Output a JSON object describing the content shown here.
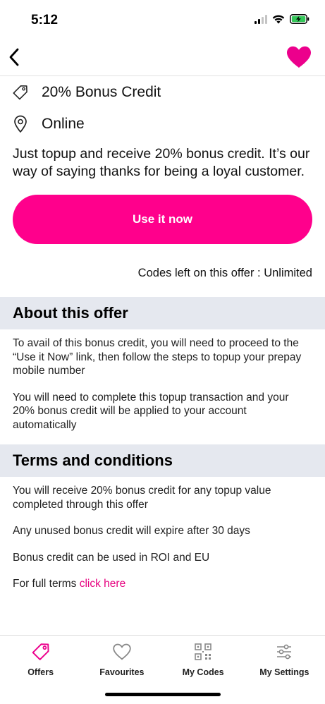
{
  "status_bar": {
    "time": "5:12",
    "icons": [
      "signal-icon",
      "wifi-icon",
      "battery-charging-icon"
    ]
  },
  "nav": {
    "back_icon": "chevron-left-icon",
    "favourite_icon": "heart-filled-icon",
    "accent_color": "#ff008c"
  },
  "offer": {
    "tag_icon": "tag-icon",
    "title": "20% Bonus Credit",
    "location_icon": "location-pin-icon",
    "location": "Online",
    "description": "Just topup and receive 20% bonus credit. It’s our way of saying thanks for being a loyal customer.",
    "cta_label": "Use it now",
    "codes_left": "Codes left on this offer : Unlimited"
  },
  "about": {
    "heading": "About this offer",
    "paragraphs": [
      "To avail of this bonus credit, you will need to proceed to the “Use it Now” link, then follow the steps to topup your prepay mobile number",
      "You will need to complete this topup transaction and your 20% bonus credit will be applied to your account automatically"
    ]
  },
  "terms": {
    "heading": "Terms and conditions",
    "paragraphs": [
      "You will receive 20% bonus credit for any topup value completed through this offer",
      "Any unused bonus credit will expire after 30 days",
      "Bonus credit can be used in ROI and EU"
    ],
    "full_terms_prefix": "For full terms ",
    "full_terms_link": "click here"
  },
  "tabs": [
    {
      "label": "Offers",
      "icon": "tag-icon",
      "active": true
    },
    {
      "label": "Favourites",
      "icon": "heart-outline-icon",
      "active": false
    },
    {
      "label": "My Codes",
      "icon": "qr-code-icon",
      "active": false
    },
    {
      "label": "My Settings",
      "icon": "sliders-icon",
      "active": false
    }
  ]
}
